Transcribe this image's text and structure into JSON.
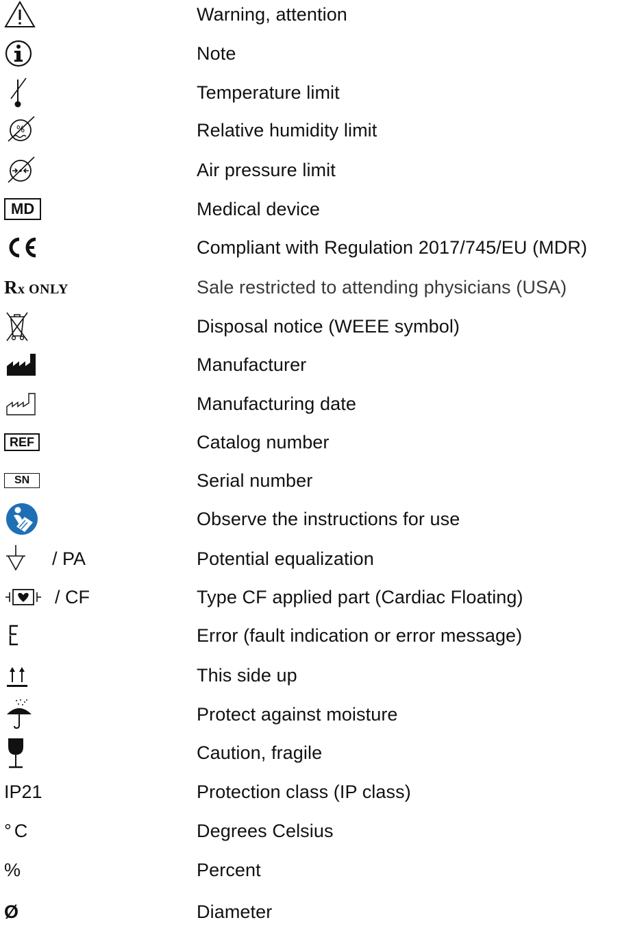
{
  "symbols": [
    {
      "icon": "warning-triangle-icon",
      "description": "Warning, attention"
    },
    {
      "icon": "info-circle-icon",
      "description": "Note"
    },
    {
      "icon": "temperature-limit-icon",
      "description": "Temperature limit"
    },
    {
      "icon": "humidity-limit-icon",
      "description": "Relative humidity limit"
    },
    {
      "icon": "air-pressure-limit-icon",
      "description": "Air pressure limit"
    },
    {
      "icon": "medical-device-icon",
      "symbol_text": "MD",
      "description": "Medical device"
    },
    {
      "icon": "ce-mark-icon",
      "description": "Compliant with Regulation 2017/745/EU (MDR)"
    },
    {
      "icon": "rx-only-icon",
      "symbol_text": "Rx ONLY",
      "description": "Sale restricted to attending physicians (USA)"
    },
    {
      "icon": "weee-bin-icon",
      "description": "Disposal notice (WEEE symbol)"
    },
    {
      "icon": "manufacturer-icon",
      "description": "Manufacturer"
    },
    {
      "icon": "manufacturing-date-icon",
      "description": "Manufacturing date"
    },
    {
      "icon": "ref-icon",
      "symbol_text": "REF",
      "description": "Catalog number"
    },
    {
      "icon": "serial-number-icon",
      "symbol_text": "SN",
      "description": "Serial number"
    },
    {
      "icon": "instructions-for-use-icon",
      "description": "Observe the instructions for use"
    },
    {
      "icon": "potential-equalization-icon",
      "symbol_suffix": "/ PA",
      "description": "Potential equalization"
    },
    {
      "icon": "type-cf-applied-part-icon",
      "symbol_suffix": "/ CF",
      "description": "Type CF applied part (Cardiac Floating)"
    },
    {
      "icon": "error-e-icon",
      "description": "Error (fault indication or error message)"
    },
    {
      "icon": "this-side-up-icon",
      "description": "This side up"
    },
    {
      "icon": "umbrella-icon",
      "description": "Protect against moisture"
    },
    {
      "icon": "fragile-glass-icon",
      "description": "Caution, fragile"
    },
    {
      "icon": "text-symbol",
      "symbol_text": "IP21",
      "description": "Protection class (IP class)"
    },
    {
      "icon": "text-symbol",
      "symbol_text": "°C",
      "description": "Degrees Celsius"
    },
    {
      "icon": "text-symbol",
      "symbol_text": "%",
      "description": "Percent"
    },
    {
      "icon": "text-symbol",
      "symbol_text": "Ø",
      "description": "Diameter"
    }
  ],
  "colors": {
    "text": "#111111",
    "ifu_icon_blue": "#1f6fb5"
  }
}
